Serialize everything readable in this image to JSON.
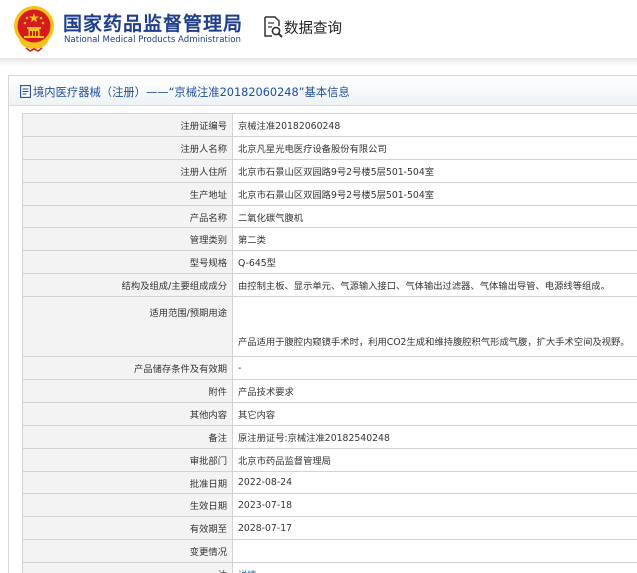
{
  "header": {
    "site_name_cn": "国家药品监督管理局",
    "site_name_en": "National Medical Products Administration",
    "icons": {
      "emblem": "national-emblem-icon",
      "query": "search-document-icon"
    },
    "query_title": "数据查询"
  },
  "panel": {
    "title": "境内医疗器械（注册）——“京械注准20182060248”基本信息",
    "title_icon": "document-icon"
  },
  "details": [
    {
      "label": "注册证编号",
      "value": "京械注准20182060248"
    },
    {
      "label": "注册人名称",
      "value": "北京凡星光电医疗设备股份有限公司"
    },
    {
      "label": "注册人住所",
      "value": "北京市石景山区双园路9号2号楼5层501-504室"
    },
    {
      "label": "生产地址",
      "value": "北京市石景山区双园路9号2号楼5层501-504室"
    },
    {
      "label": "产品名称",
      "value": "二氧化碳气腹机"
    },
    {
      "label": "管理类别",
      "value": "第二类"
    },
    {
      "label": "型号规格",
      "value": "Q-645型"
    },
    {
      "label": "结构及组成/主要组成成分",
      "value": "由控制主板、显示单元、气源输入接口、气体输出过滤器、气体输出导管、电源线等组成。"
    },
    {
      "label": "适用范围/预期用途",
      "value": "产品适用于腹腔内窥镜手术时，利用CO2生成和维持腹腔积气形成气腹，扩大手术空间及视野。"
    },
    {
      "label": "产品储存条件及有效期",
      "value": "-"
    },
    {
      "label": "附件",
      "value": "产品技术要求"
    },
    {
      "label": "其他内容",
      "value": "其它内容"
    },
    {
      "label": "备注",
      "value": "原注册证号:京械注准20182540248"
    },
    {
      "label": "审批部门",
      "value": "北京市药品监督管理局"
    },
    {
      "label": "批准日期",
      "value": "2022-08-24"
    },
    {
      "label": "生效日期",
      "value": "2023-07-18"
    },
    {
      "label": "有效期至",
      "value": "2028-07-17"
    },
    {
      "label": "变更情况",
      "value": ""
    },
    {
      "label": "注",
      "value": "详情"
    }
  ],
  "colors": {
    "brand_blue": "#1f3f8c",
    "emblem_red": "#d71920",
    "emblem_gold": "#f6c21a",
    "link_blue": "#2266bb"
  }
}
